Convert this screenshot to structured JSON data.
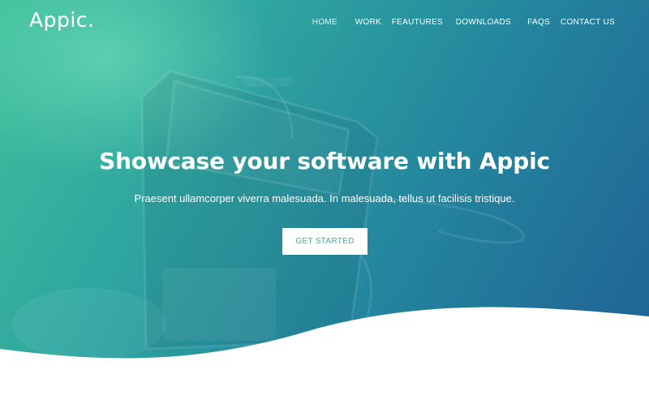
{
  "brand": {
    "logo_text": "Appic."
  },
  "nav": {
    "items": [
      {
        "label": "HOME",
        "active": true
      },
      {
        "label": "WORK"
      },
      {
        "label": "FEAUTURES"
      },
      {
        "label": "DOWNLOADS"
      },
      {
        "label": "FAQS"
      },
      {
        "label": "CONTACT US"
      }
    ]
  },
  "hero": {
    "title": "Showcase your software with Appic",
    "subtitle": "Praesent ullamcorper viverra malesuada. In malesuada, tellus ut facilisis tristique.",
    "cta_label": "GET STARTED"
  },
  "colors": {
    "gradient_start": "#3fbf9a",
    "gradient_end": "#1f5f94",
    "cta_text": "#3bb495",
    "page_background": "#ffffff"
  }
}
